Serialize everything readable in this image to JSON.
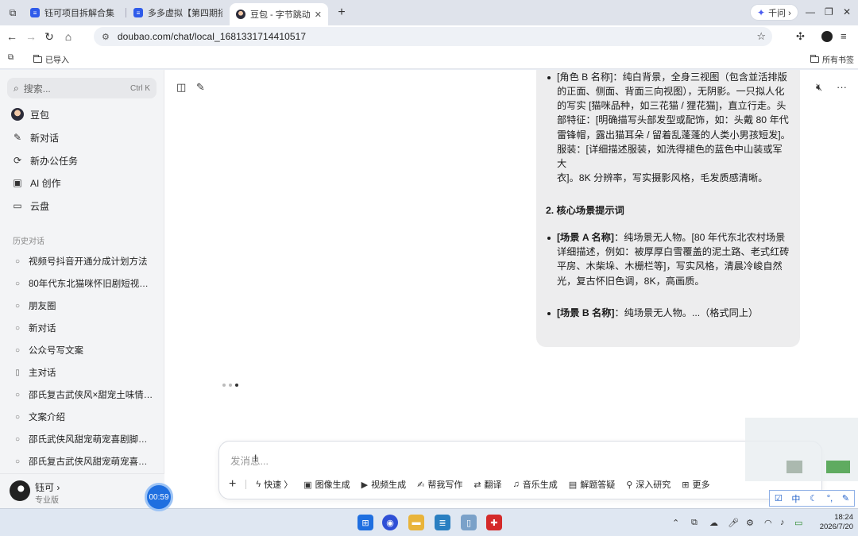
{
  "browser": {
    "tabs": [
      {
        "label": "钰可项目拆解合集【每日",
        "active": false
      },
      {
        "label": "多多虚拟【第四期招募】",
        "active": false
      },
      {
        "label": "豆包 - 字节跳动旗下",
        "active": true
      }
    ],
    "ask_button": "千问 ›",
    "url": "doubao.com/chat/local_1681331714410517",
    "bookmarks": {
      "imported": "已导入",
      "all": "所有书签"
    }
  },
  "sidebar": {
    "search_placeholder": "搜索...",
    "search_shortcut": "Ctrl K",
    "nav": [
      {
        "label": "豆包",
        "icon": "doubao-avatar-icon"
      },
      {
        "label": "新对话",
        "icon": "edit-icon"
      },
      {
        "label": "新办公任务",
        "icon": "office-task-icon"
      },
      {
        "label": "AI 创作",
        "icon": "image-icon"
      },
      {
        "label": "云盘",
        "icon": "folder-icon"
      }
    ],
    "history_title": "历史对话",
    "history": [
      "视频号抖音开通分成计划方法",
      "80年代东北猫咪怀旧剧短视频...",
      "朋友圈",
      "新对话",
      "公众号写文案",
      "主对话",
      "邵氏复古武侠风×甜宠土味情话...",
      "文案介绍",
      "邵氏武侠风甜宠萌宠喜剧脚本（...",
      "邵氏复古武侠风甜宠萌宠喜剧脚..."
    ],
    "user": {
      "name": "钰可 ›",
      "plan": "专业版"
    },
    "timer": "00:59"
  },
  "message": {
    "line0": "[角色 B 名称]：纯白背景，全身三视图（包含並活排版",
    "p1_lines": [
      "的正面、侧面、背面三向视图），无阴影。一只拟人化",
      "的写实 [猫咪品种，如三花猫 / 狸花猫]，直立行走。头",
      "部特征：[明确描写头部发型或配饰，如：头戴 80 年代",
      "雷锋帽，露出猫耳朵 / 留着乱蓬蓬的人类小男孩短发]。",
      "服装：[详细描述服装，如洗得褪色的蓝色中山装或军大",
      "衣]。8K 分辨率，写实摄影风格，毛发质感清晰。"
    ],
    "heading2": "2. 核心场景提示词",
    "sceneA_name": "[场景 A 名称]",
    "sceneA_lines": [
      "：纯场景无人物。[80 年代东北农村场景",
      "详细描述，例如：被厚厚白雪覆盖的泥土路、老式红砖",
      "平房、木柴垛、木栅栏等]，写实风格，清晨冷峻自然",
      "光，复古怀旧色调，8K，高画质。"
    ],
    "sceneB_name": "[场景 B 名称]",
    "sceneB_text": "：纯场景无人物。...（格式同上）"
  },
  "composer": {
    "placeholder": "发消息...",
    "tools": [
      {
        "label": "快速 〉",
        "icon": "lightning-icon"
      },
      {
        "label": "图像生成",
        "icon": "image-gen-icon"
      },
      {
        "label": "视频生成",
        "icon": "video-gen-icon"
      },
      {
        "label": "帮我写作",
        "icon": "writing-icon"
      },
      {
        "label": "翻译",
        "icon": "translate-icon"
      },
      {
        "label": "音乐生成",
        "icon": "music-icon"
      },
      {
        "label": "解题答疑",
        "icon": "solve-icon"
      },
      {
        "label": "深入研究",
        "icon": "research-icon"
      },
      {
        "label": "更多",
        "icon": "more-grid-icon"
      }
    ]
  },
  "ime": {
    "lang": "中"
  },
  "taskbar": {
    "time": "18:24",
    "date": "2026/7/20"
  },
  "colors": {
    "accent": "#1f6fe0",
    "bubble": "#ededee",
    "sidebar": "#f3f4f6"
  }
}
